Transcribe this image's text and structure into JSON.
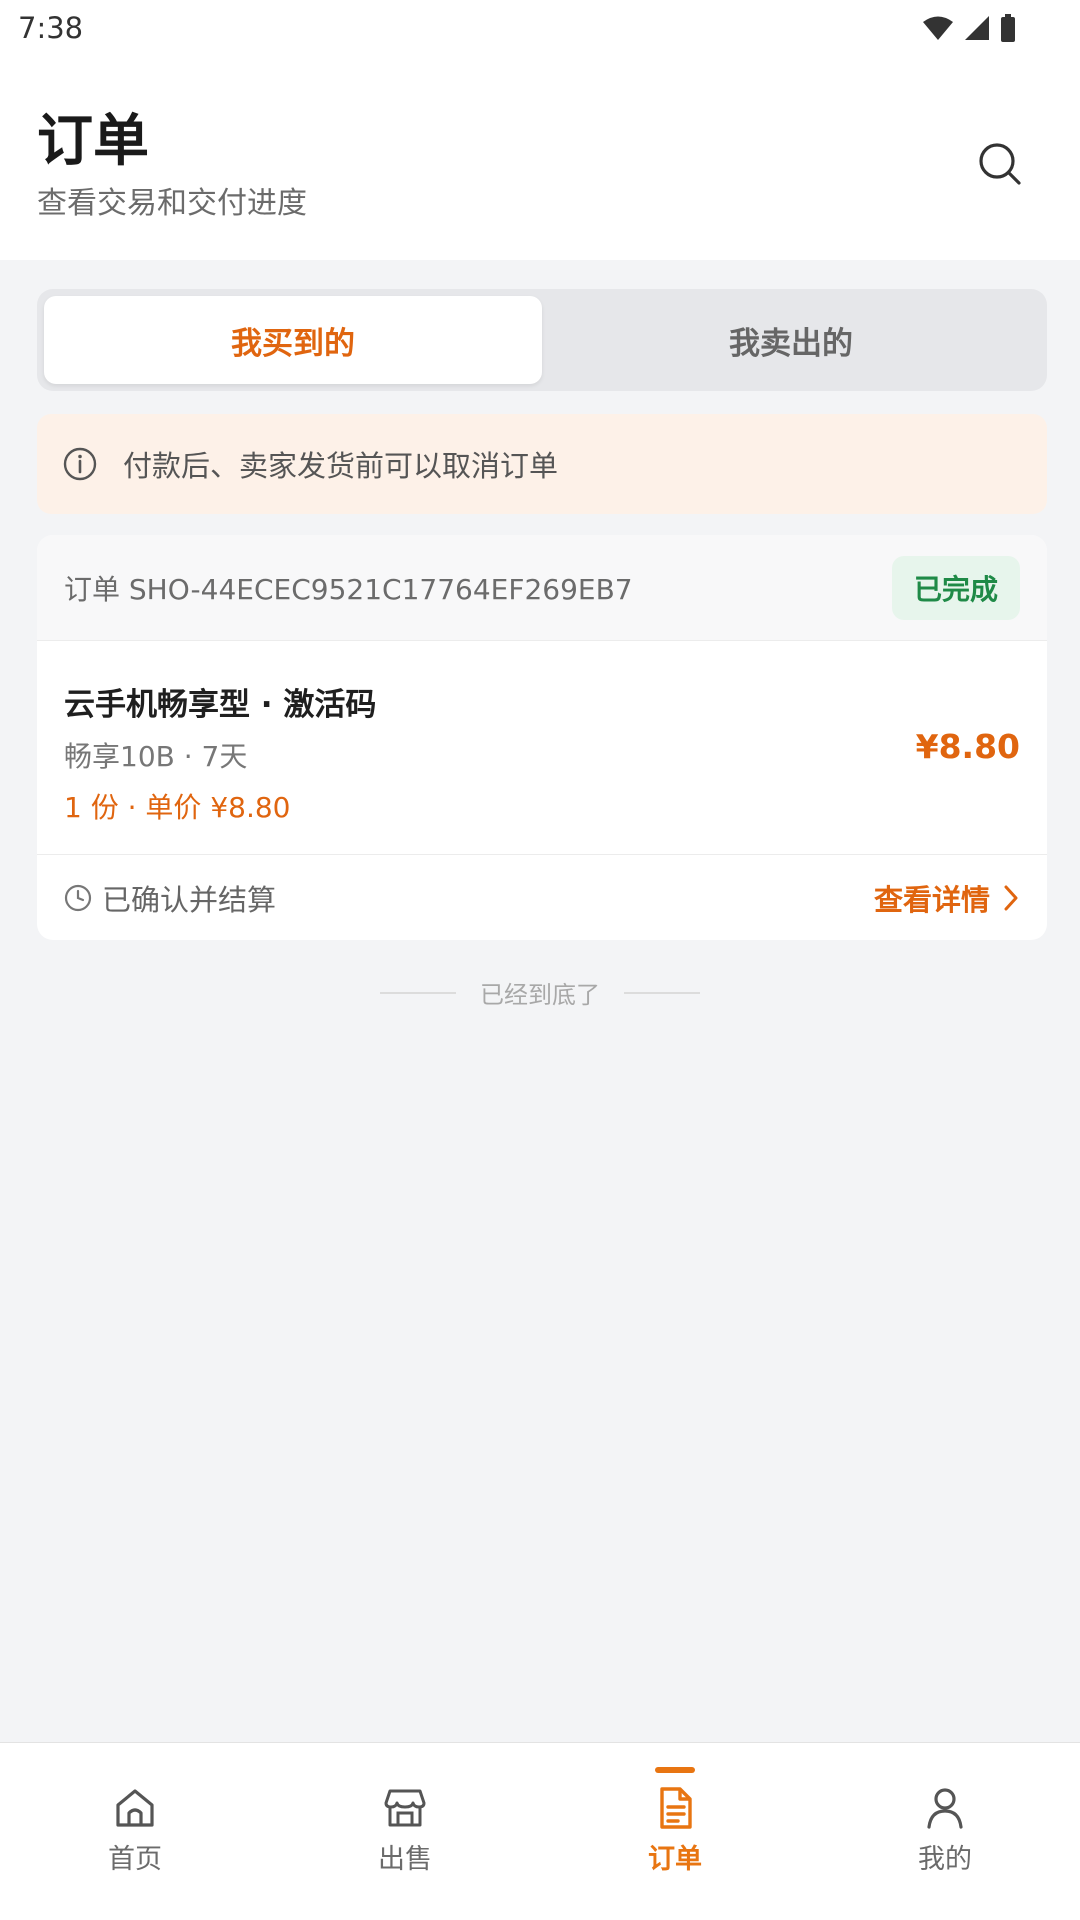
{
  "status_bar": {
    "time": "7:38"
  },
  "header": {
    "title": "订单",
    "subtitle": "查看交易和交付进度"
  },
  "tabs": [
    {
      "label": "我买到的",
      "active": true
    },
    {
      "label": "我卖出的",
      "active": false
    }
  ],
  "notice": {
    "icon": "info-icon",
    "text": "付款后、卖家发货前可以取消订单"
  },
  "order": {
    "order_id": "订单 SHO-44ECEC9521C17764EF269EB7",
    "status": "已完成",
    "product_name": "云手机畅享型 · 激活码",
    "spec": "畅享10B · 7天",
    "quantity_price": "1 份 · 单价 ¥8.80",
    "price": "¥8.80",
    "settle_status": "已确认并结算",
    "detail_link": "查看详情"
  },
  "end_marker": "已经到底了",
  "bottom_nav": [
    {
      "label": "首页",
      "icon": "home-icon",
      "active": false
    },
    {
      "label": "出售",
      "icon": "store-icon",
      "active": false
    },
    {
      "label": "订单",
      "icon": "document-icon",
      "active": true
    },
    {
      "label": "我的",
      "icon": "user-icon",
      "active": false
    }
  ],
  "colors": {
    "accent": "#e0650f",
    "success": "#1f8a47",
    "notice_bg": "#fdf1e8",
    "page_bg": "#f3f4f6"
  }
}
